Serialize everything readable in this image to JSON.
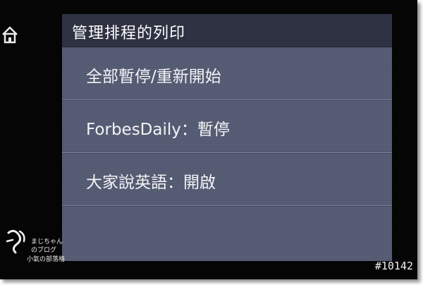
{
  "screen": {
    "title": "管理排程的列印",
    "items": [
      {
        "label": "全部暫停/重新開始"
      },
      {
        "label": "ForbesDaily：暫停"
      },
      {
        "label": "大家說英語：開啟"
      }
    ]
  },
  "watermark": {
    "line1": "まじちゃん",
    "line2": "のブログ",
    "line3": "小氣の部落格"
  },
  "photo_id": "#10142",
  "icons": {
    "home": "home-icon"
  },
  "colors": {
    "screen_bg": "#545b73",
    "titlebar_bg": "#2e3243",
    "frame": "#050505"
  }
}
